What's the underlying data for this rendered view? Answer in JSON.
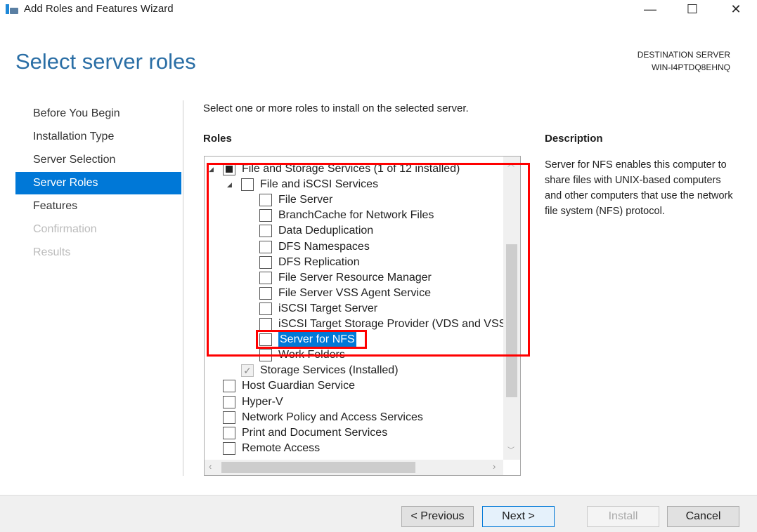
{
  "window": {
    "title": "Add Roles and Features Wizard",
    "icon": "server-manager-icon"
  },
  "page": {
    "heading": "Select server roles",
    "destination_label": "DESTINATION SERVER",
    "destination_server": "WIN-I4PTDQ8EHNQ",
    "instruction": "Select one or more roles to install on the selected server.",
    "roles_label": "Roles",
    "description_label": "Description",
    "description": "Server for NFS enables this computer to share files with UNIX-based computers and other computers that use the network file system (NFS) protocol."
  },
  "nav": [
    {
      "label": "Before You Begin",
      "state": "normal"
    },
    {
      "label": "Installation Type",
      "state": "normal"
    },
    {
      "label": "Server Selection",
      "state": "normal"
    },
    {
      "label": "Server Roles",
      "state": "selected"
    },
    {
      "label": "Features",
      "state": "normal"
    },
    {
      "label": "Confirmation",
      "state": "disabled"
    },
    {
      "label": "Results",
      "state": "disabled"
    }
  ],
  "roles": [
    {
      "label": "File and Storage Services (1 of 12 installed)",
      "level": 0,
      "expanded": true,
      "check": "partial"
    },
    {
      "label": "File and iSCSI Services",
      "level": 1,
      "expanded": true,
      "check": "none"
    },
    {
      "label": "File Server",
      "level": 2,
      "check": "none"
    },
    {
      "label": "BranchCache for Network Files",
      "level": 2,
      "check": "none"
    },
    {
      "label": "Data Deduplication",
      "level": 2,
      "check": "none"
    },
    {
      "label": "DFS Namespaces",
      "level": 2,
      "check": "none"
    },
    {
      "label": "DFS Replication",
      "level": 2,
      "check": "none"
    },
    {
      "label": "File Server Resource Manager",
      "level": 2,
      "check": "none"
    },
    {
      "label": "File Server VSS Agent Service",
      "level": 2,
      "check": "none"
    },
    {
      "label": "iSCSI Target Server",
      "level": 2,
      "check": "none"
    },
    {
      "label": "iSCSI Target Storage Provider (VDS and VSS hardware providers)",
      "level": 2,
      "check": "none"
    },
    {
      "label": "Server for NFS",
      "level": 2,
      "check": "none",
      "selected": true
    },
    {
      "label": "Work Folders",
      "level": 2,
      "check": "none"
    },
    {
      "label": "Storage Services (Installed)",
      "level": 1,
      "check": "checked"
    },
    {
      "label": "Host Guardian Service",
      "level": 0,
      "check": "none"
    },
    {
      "label": "Hyper-V",
      "level": 0,
      "check": "none"
    },
    {
      "label": "Network Policy and Access Services",
      "level": 0,
      "check": "none"
    },
    {
      "label": "Print and Document Services",
      "level": 0,
      "check": "none"
    },
    {
      "label": "Remote Access",
      "level": 0,
      "check": "none"
    }
  ],
  "buttons": {
    "previous": "< Previous",
    "next": "Next >",
    "install": "Install",
    "cancel": "Cancel"
  },
  "colors": {
    "accent": "#0078d7",
    "annotation": "#ff0000",
    "heading": "#2a6ea5"
  }
}
